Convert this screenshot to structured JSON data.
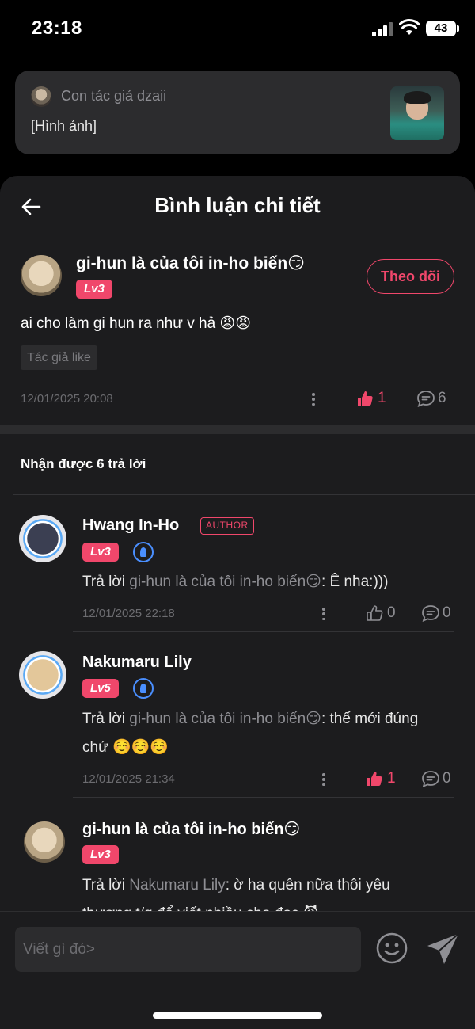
{
  "status_bar": {
    "time": "23:18",
    "battery": "43"
  },
  "notification": {
    "author": "Con tác giả dzaii",
    "message": "[Hình ảnh]"
  },
  "header": {
    "title": "Bình luận chi tiết"
  },
  "main_comment": {
    "author": "gi-hun là của tôi in-ho biến😏",
    "level": "Lv3",
    "follow_label": "Theo dõi",
    "text": "ai cho làm gi hun ra như v hả 😡😡",
    "author_like_tag": "Tác giả like",
    "date": "12/01/2025 20:08",
    "likes": "1",
    "comments": "6"
  },
  "replies_header": "Nhận được 6 trả lời",
  "replies": [
    {
      "author": "Hwang In-Ho",
      "badge": "AUTHOR",
      "level": "Lv3",
      "prefix": "Trả lời ",
      "mention": "gi-hun là của tôi in-ho biến😏",
      "text": ": Ê nha:)))",
      "date": "12/01/2025 22:18",
      "likes": "0",
      "comments": "0"
    },
    {
      "author": "Nakumaru Lily",
      "level": "Lv5",
      "prefix": "Trả lời ",
      "mention": "gi-hun là của tôi in-ho biến😏",
      "text": ": thế mới đúng chứ ☺️☺️☺️",
      "date": "12/01/2025 21:34",
      "likes": "1",
      "comments": "0"
    },
    {
      "author": "gi-hun là của tôi in-ho biến😏",
      "level": "Lv3",
      "prefix": "Trả lời ",
      "mention": "Nakumaru Lily",
      "text": ": ờ ha quên nữa thôi yêu thương t/g để viết nhiều cho đọc 😈"
    }
  ],
  "input": {
    "placeholder": "Viết gì đó>"
  },
  "colors": {
    "accent": "#f0476b",
    "background": "#1c1c1e",
    "verified": "#4a8fff"
  }
}
